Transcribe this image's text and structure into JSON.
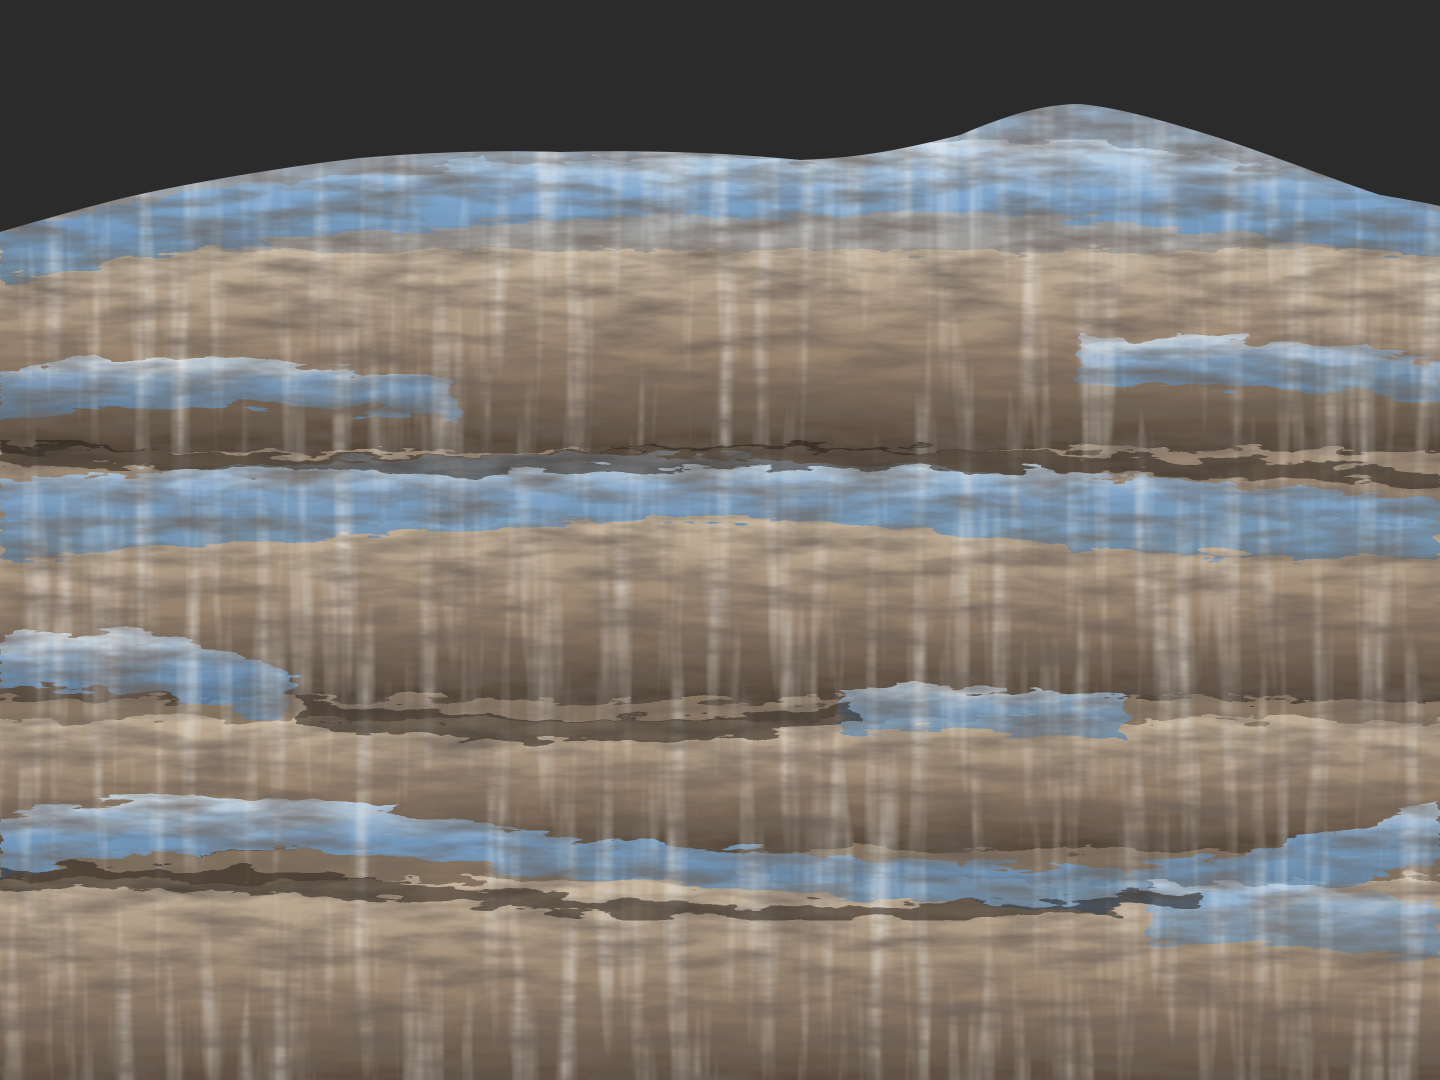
{
  "scene": {
    "subject": "sculpted-rock-cliff-terrain",
    "view": "3d-viewport-render",
    "colors": {
      "background": "#2b2b2b",
      "rock_base": "#9c8a74",
      "rock_light": "#d9cbb6",
      "rock_shadow": "#3a3128",
      "sky_reflection": "#6f9fcf",
      "highlight": "#e8f1f8"
    }
  }
}
